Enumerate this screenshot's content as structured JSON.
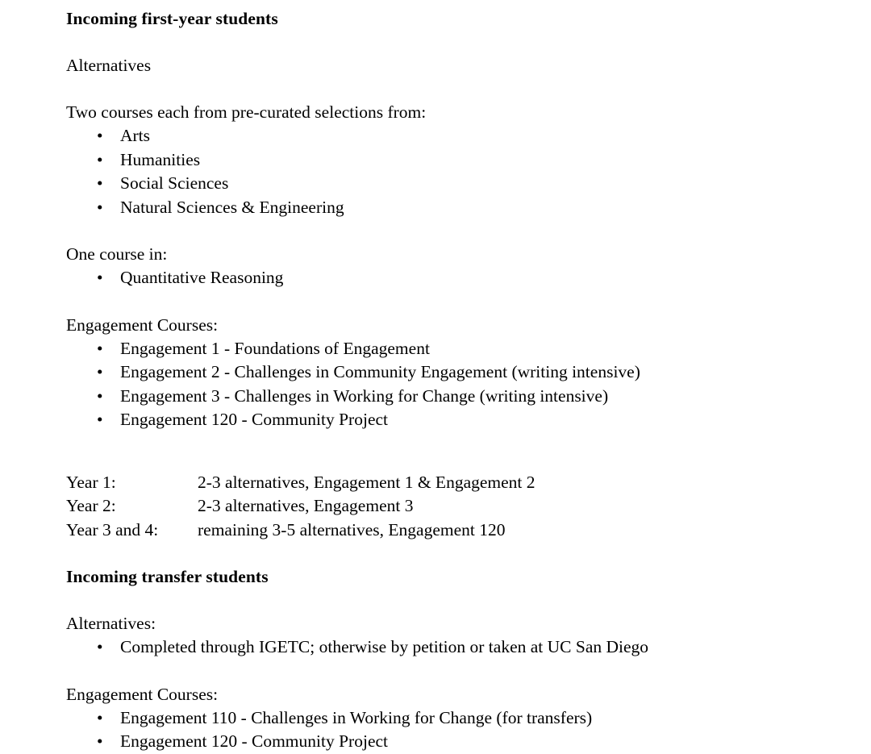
{
  "document": {
    "bullet_glyph": "•",
    "text_color": "#000000",
    "background_color": "#ffffff",
    "sections": [
      {
        "heading": "Incoming first-year students",
        "subheading": "Alternatives",
        "intro": "Two courses each from pre-curated selections from:",
        "areas": [
          "Arts",
          "Humanities",
          "Social Sciences",
          "Natural Sciences & Engineering"
        ],
        "one_course_label": "One course in:",
        "one_course_items": [
          "Quantitative Reasoning"
        ],
        "engagement_label": "Engagement Courses:",
        "engagement_items": [
          "Engagement 1 - Foundations of Engagement",
          "Engagement 2 - Challenges in Community Engagement (writing intensive)",
          "Engagement 3 - Challenges in Working for Change (writing intensive)",
          "Engagement 120 - Community Project"
        ],
        "year_plan": [
          {
            "label": "Year 1:",
            "value": "2-3 alternatives, Engagement 1 & Engagement 2"
          },
          {
            "label": "Year 2:",
            "value": "2-3 alternatives, Engagement 3"
          },
          {
            "label": "Year 3 and 4:",
            "value": "remaining 3-5 alternatives, Engagement 120"
          }
        ]
      },
      {
        "heading": "Incoming transfer students",
        "alternatives_label": "Alternatives:",
        "alternatives_items": [
          "Completed through IGETC; otherwise by petition or taken at UC San Diego"
        ],
        "engagement_label": "Engagement Courses:",
        "engagement_items": [
          "Engagement 110 - Challenges in Working for Change (for transfers)",
          "Engagement 120 - Community Project"
        ]
      }
    ]
  }
}
